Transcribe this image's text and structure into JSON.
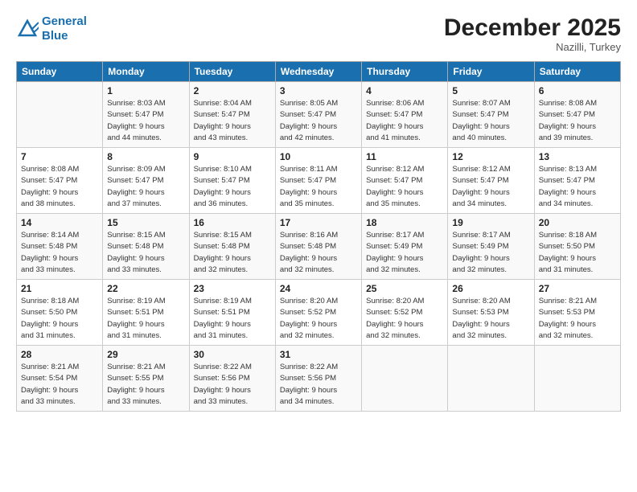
{
  "logo": {
    "line1": "General",
    "line2": "Blue"
  },
  "title": "December 2025",
  "location": "Nazilli, Turkey",
  "weekdays": [
    "Sunday",
    "Monday",
    "Tuesday",
    "Wednesday",
    "Thursday",
    "Friday",
    "Saturday"
  ],
  "weeks": [
    [
      {
        "day": "",
        "sunrise": "",
        "sunset": "",
        "daylight": ""
      },
      {
        "day": "1",
        "sunrise": "Sunrise: 8:03 AM",
        "sunset": "Sunset: 5:47 PM",
        "daylight": "Daylight: 9 hours and 44 minutes."
      },
      {
        "day": "2",
        "sunrise": "Sunrise: 8:04 AM",
        "sunset": "Sunset: 5:47 PM",
        "daylight": "Daylight: 9 hours and 43 minutes."
      },
      {
        "day": "3",
        "sunrise": "Sunrise: 8:05 AM",
        "sunset": "Sunset: 5:47 PM",
        "daylight": "Daylight: 9 hours and 42 minutes."
      },
      {
        "day": "4",
        "sunrise": "Sunrise: 8:06 AM",
        "sunset": "Sunset: 5:47 PM",
        "daylight": "Daylight: 9 hours and 41 minutes."
      },
      {
        "day": "5",
        "sunrise": "Sunrise: 8:07 AM",
        "sunset": "Sunset: 5:47 PM",
        "daylight": "Daylight: 9 hours and 40 minutes."
      },
      {
        "day": "6",
        "sunrise": "Sunrise: 8:08 AM",
        "sunset": "Sunset: 5:47 PM",
        "daylight": "Daylight: 9 hours and 39 minutes."
      }
    ],
    [
      {
        "day": "7",
        "sunrise": "Sunrise: 8:08 AM",
        "sunset": "Sunset: 5:47 PM",
        "daylight": "Daylight: 9 hours and 38 minutes."
      },
      {
        "day": "8",
        "sunrise": "Sunrise: 8:09 AM",
        "sunset": "Sunset: 5:47 PM",
        "daylight": "Daylight: 9 hours and 37 minutes."
      },
      {
        "day": "9",
        "sunrise": "Sunrise: 8:10 AM",
        "sunset": "Sunset: 5:47 PM",
        "daylight": "Daylight: 9 hours and 36 minutes."
      },
      {
        "day": "10",
        "sunrise": "Sunrise: 8:11 AM",
        "sunset": "Sunset: 5:47 PM",
        "daylight": "Daylight: 9 hours and 35 minutes."
      },
      {
        "day": "11",
        "sunrise": "Sunrise: 8:12 AM",
        "sunset": "Sunset: 5:47 PM",
        "daylight": "Daylight: 9 hours and 35 minutes."
      },
      {
        "day": "12",
        "sunrise": "Sunrise: 8:12 AM",
        "sunset": "Sunset: 5:47 PM",
        "daylight": "Daylight: 9 hours and 34 minutes."
      },
      {
        "day": "13",
        "sunrise": "Sunrise: 8:13 AM",
        "sunset": "Sunset: 5:47 PM",
        "daylight": "Daylight: 9 hours and 34 minutes."
      }
    ],
    [
      {
        "day": "14",
        "sunrise": "Sunrise: 8:14 AM",
        "sunset": "Sunset: 5:48 PM",
        "daylight": "Daylight: 9 hours and 33 minutes."
      },
      {
        "day": "15",
        "sunrise": "Sunrise: 8:15 AM",
        "sunset": "Sunset: 5:48 PM",
        "daylight": "Daylight: 9 hours and 33 minutes."
      },
      {
        "day": "16",
        "sunrise": "Sunrise: 8:15 AM",
        "sunset": "Sunset: 5:48 PM",
        "daylight": "Daylight: 9 hours and 32 minutes."
      },
      {
        "day": "17",
        "sunrise": "Sunrise: 8:16 AM",
        "sunset": "Sunset: 5:48 PM",
        "daylight": "Daylight: 9 hours and 32 minutes."
      },
      {
        "day": "18",
        "sunrise": "Sunrise: 8:17 AM",
        "sunset": "Sunset: 5:49 PM",
        "daylight": "Daylight: 9 hours and 32 minutes."
      },
      {
        "day": "19",
        "sunrise": "Sunrise: 8:17 AM",
        "sunset": "Sunset: 5:49 PM",
        "daylight": "Daylight: 9 hours and 32 minutes."
      },
      {
        "day": "20",
        "sunrise": "Sunrise: 8:18 AM",
        "sunset": "Sunset: 5:50 PM",
        "daylight": "Daylight: 9 hours and 31 minutes."
      }
    ],
    [
      {
        "day": "21",
        "sunrise": "Sunrise: 8:18 AM",
        "sunset": "Sunset: 5:50 PM",
        "daylight": "Daylight: 9 hours and 31 minutes."
      },
      {
        "day": "22",
        "sunrise": "Sunrise: 8:19 AM",
        "sunset": "Sunset: 5:51 PM",
        "daylight": "Daylight: 9 hours and 31 minutes."
      },
      {
        "day": "23",
        "sunrise": "Sunrise: 8:19 AM",
        "sunset": "Sunset: 5:51 PM",
        "daylight": "Daylight: 9 hours and 31 minutes."
      },
      {
        "day": "24",
        "sunrise": "Sunrise: 8:20 AM",
        "sunset": "Sunset: 5:52 PM",
        "daylight": "Daylight: 9 hours and 32 minutes."
      },
      {
        "day": "25",
        "sunrise": "Sunrise: 8:20 AM",
        "sunset": "Sunset: 5:52 PM",
        "daylight": "Daylight: 9 hours and 32 minutes."
      },
      {
        "day": "26",
        "sunrise": "Sunrise: 8:20 AM",
        "sunset": "Sunset: 5:53 PM",
        "daylight": "Daylight: 9 hours and 32 minutes."
      },
      {
        "day": "27",
        "sunrise": "Sunrise: 8:21 AM",
        "sunset": "Sunset: 5:53 PM",
        "daylight": "Daylight: 9 hours and 32 minutes."
      }
    ],
    [
      {
        "day": "28",
        "sunrise": "Sunrise: 8:21 AM",
        "sunset": "Sunset: 5:54 PM",
        "daylight": "Daylight: 9 hours and 33 minutes."
      },
      {
        "day": "29",
        "sunrise": "Sunrise: 8:21 AM",
        "sunset": "Sunset: 5:55 PM",
        "daylight": "Daylight: 9 hours and 33 minutes."
      },
      {
        "day": "30",
        "sunrise": "Sunrise: 8:22 AM",
        "sunset": "Sunset: 5:56 PM",
        "daylight": "Daylight: 9 hours and 33 minutes."
      },
      {
        "day": "31",
        "sunrise": "Sunrise: 8:22 AM",
        "sunset": "Sunset: 5:56 PM",
        "daylight": "Daylight: 9 hours and 34 minutes."
      },
      {
        "day": "",
        "sunrise": "",
        "sunset": "",
        "daylight": ""
      },
      {
        "day": "",
        "sunrise": "",
        "sunset": "",
        "daylight": ""
      },
      {
        "day": "",
        "sunrise": "",
        "sunset": "",
        "daylight": ""
      }
    ]
  ]
}
